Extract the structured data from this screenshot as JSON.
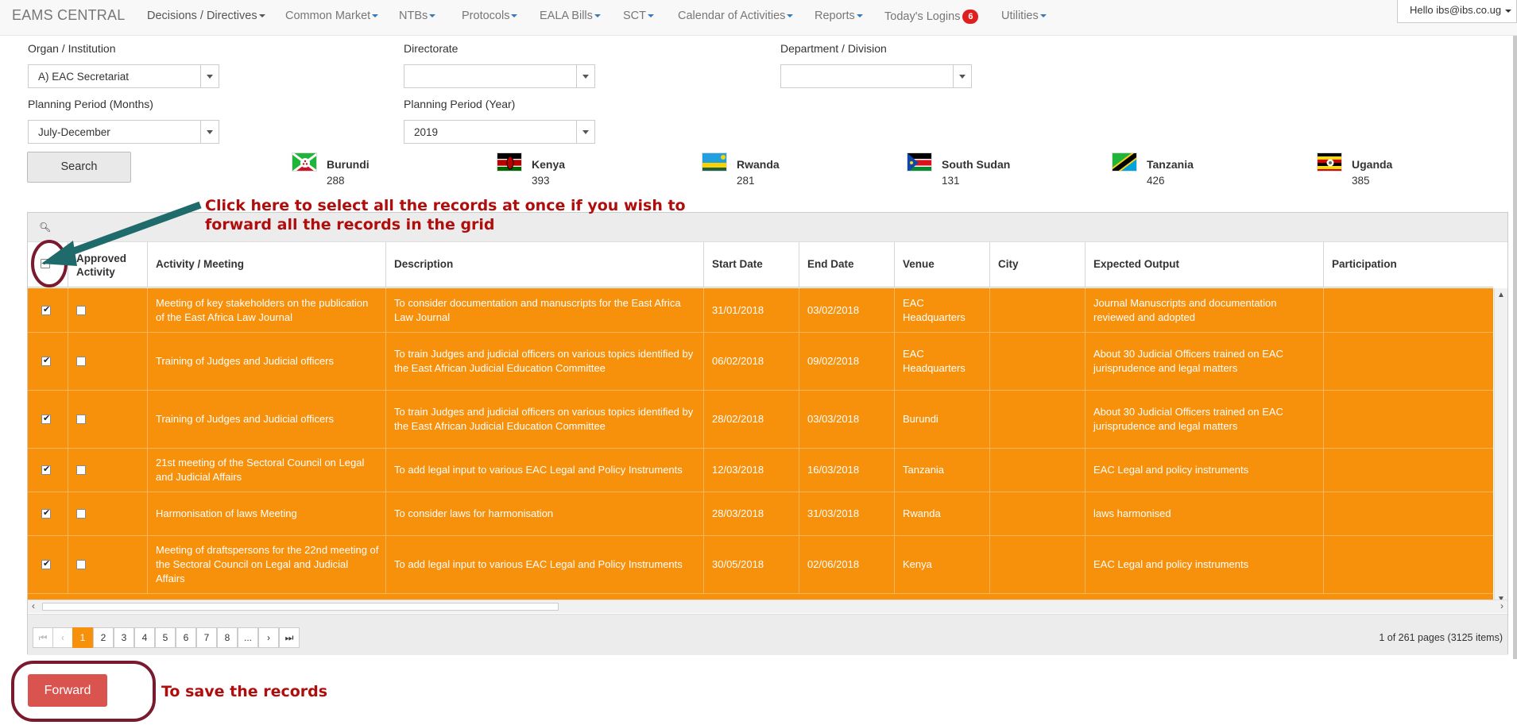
{
  "nav": {
    "brand": "EAMS CENTRAL",
    "items": [
      {
        "label": "Decisions / Directives"
      },
      {
        "label": "Common Market"
      },
      {
        "label": "NTBs"
      },
      {
        "label": "Protocols"
      },
      {
        "label": "EALA Bills"
      },
      {
        "label": "SCT"
      },
      {
        "label": "Calendar of Activities"
      },
      {
        "label": "Reports"
      },
      {
        "label": "Utilities"
      }
    ],
    "logins_label": "Today's Logins",
    "logins_count": "6",
    "user_greeting": "Hello ibs@ibs.co.ug"
  },
  "filters": {
    "organ_label": "Organ / Institution",
    "organ_value": "A) EAC Secretariat",
    "directorate_label": "Directorate",
    "directorate_value": "",
    "department_label": "Department / Division",
    "department_value": "",
    "months_label": "Planning Period (Months)",
    "months_value": "July-December",
    "year_label": "Planning Period (Year)",
    "year_value": "2019",
    "search_label": "Search"
  },
  "countries": [
    {
      "name": "Burundi",
      "count": "288",
      "flag_icon": "burundi-flag"
    },
    {
      "name": "Kenya",
      "count": "393",
      "flag_icon": "kenya-flag"
    },
    {
      "name": "Rwanda",
      "count": "281",
      "flag_icon": "rwanda-flag"
    },
    {
      "name": "South Sudan",
      "count": "131",
      "flag_icon": "south-sudan-flag"
    },
    {
      "name": "Tanzania",
      "count": "426",
      "flag_icon": "tanzania-flag"
    },
    {
      "name": "Uganda",
      "count": "385",
      "flag_icon": "uganda-flag"
    }
  ],
  "grid": {
    "search_icon": "search-icon",
    "columns": {
      "approved": "Approved Activity",
      "activity": "Activity / Meeting",
      "description": "Description",
      "start": "Start Date",
      "end": "End Date",
      "venue": "Venue",
      "city": "City",
      "output": "Expected Output",
      "participation": "Participation"
    },
    "rows": [
      {
        "activity": "Meeting of key stakeholders on the publication of the East Africa Law Journal",
        "description": "To consider documentation and manuscripts for the East Africa Law Journal",
        "start": "31/01/2018",
        "end": "03/02/2018",
        "venue": "EAC Headquarters",
        "city": "",
        "output": "Journal Manuscripts and documentation reviewed and adopted",
        "participation": ""
      },
      {
        "activity": "Training of Judges and Judicial officers",
        "description": "To train Judges and judicial officers on various topics identified by the East African Judicial Education Committee",
        "start": "06/02/2018",
        "end": "09/02/2018",
        "venue": "EAC Headquarters",
        "city": "",
        "output": "About 30 Judicial Officers trained on EAC jurisprudence and legal matters",
        "participation": ""
      },
      {
        "activity": "Training of Judges and Judicial officers",
        "description": "To train Judges and judicial officers on various topics identified by the East African Judicial Education Committee",
        "start": "28/02/2018",
        "end": "03/03/2018",
        "venue": "Burundi",
        "city": "",
        "output": "About 30 Judicial Officers trained on EAC jurisprudence and legal matters",
        "participation": ""
      },
      {
        "activity": "21st meeting of the Sectoral Council on Legal and Judicial Affairs",
        "description": "To add legal input to various EAC Legal and Policy Instruments",
        "start": "12/03/2018",
        "end": "16/03/2018",
        "venue": "Tanzania",
        "city": "",
        "output": "EAC Legal and policy instruments",
        "participation": ""
      },
      {
        "activity": "Harmonisation of laws Meeting",
        "description": "To consider laws for harmonisation",
        "start": "28/03/2018",
        "end": "31/03/2018",
        "venue": "Rwanda",
        "city": "",
        "output": "laws harmonised",
        "participation": ""
      },
      {
        "activity": "Meeting of draftspersons for the 22nd meeting of the Sectoral Council on Legal and Judicial Affairs",
        "description": "To add legal input to various EAC Legal and Policy Instruments",
        "start": "30/05/2018",
        "end": "02/06/2018",
        "venue": "Kenya",
        "city": "",
        "output": "EAC Legal and policy instruments",
        "participation": ""
      }
    ],
    "pager": {
      "pages": [
        "1",
        "2",
        "3",
        "4",
        "5",
        "6",
        "7",
        "8",
        "..."
      ],
      "current": "1",
      "first_icon": "⏮",
      "prev_icon": "‹",
      "next_icon": "›",
      "last_icon": "⏭",
      "info": "1 of 261 pages (3125 items)"
    }
  },
  "forward_label": "Forward",
  "annotations": {
    "select_all_line1": "Click here to select all the records at once if you wish to",
    "select_all_line2": "forward all the records in the grid",
    "save": "To save the records"
  },
  "colors": {
    "row_bg": "#f7900b",
    "annotation": "#b00d0d",
    "arrow": "#1f6b6b",
    "forward_btn": "#d9534f",
    "highlight_ring": "#7a1a2e"
  }
}
